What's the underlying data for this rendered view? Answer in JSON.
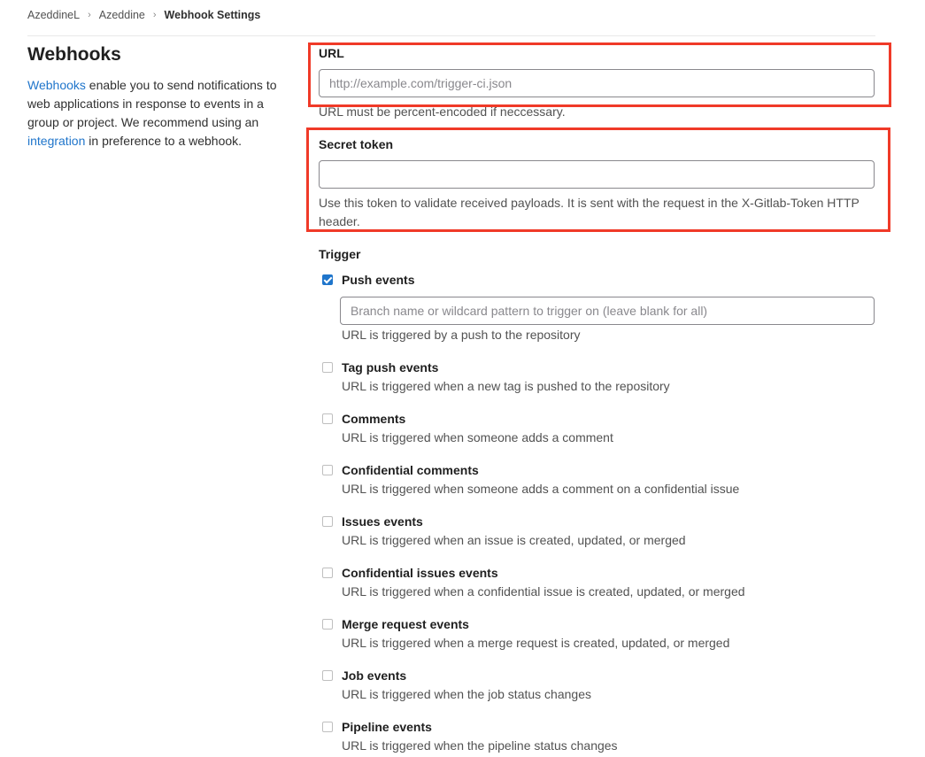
{
  "breadcrumb": {
    "items": [
      "AzeddineL",
      "Azeddine",
      "Webhook Settings"
    ]
  },
  "sidebar": {
    "title": "Webhooks",
    "webhooks_link": "Webhooks",
    "text_part1": " enable you to send notifications to web applications in response to events in a group or project. We recommend using an ",
    "integration_link": "integration",
    "text_part2": " in preference to a webhook."
  },
  "url_field": {
    "label": "URL",
    "placeholder": "http://example.com/trigger-ci.json",
    "value": "",
    "help": "URL must be percent-encoded if neccessary."
  },
  "secret_token": {
    "label": "Secret token",
    "value": "",
    "help": "Use this token to validate received payloads. It is sent with the request in the X-Gitlab-Token HTTP header."
  },
  "trigger": {
    "heading": "Trigger",
    "push_branch_placeholder": "Branch name or wildcard pattern to trigger on (leave blank for all)",
    "events": [
      {
        "title": "Push events",
        "desc": "URL is triggered by a push to the repository",
        "checked": true
      },
      {
        "title": "Tag push events",
        "desc": "URL is triggered when a new tag is pushed to the repository",
        "checked": false
      },
      {
        "title": "Comments",
        "desc": "URL is triggered when someone adds a comment",
        "checked": false
      },
      {
        "title": "Confidential comments",
        "desc": "URL is triggered when someone adds a comment on a confidential issue",
        "checked": false
      },
      {
        "title": "Issues events",
        "desc": "URL is triggered when an issue is created, updated, or merged",
        "checked": false
      },
      {
        "title": "Confidential issues events",
        "desc": "URL is triggered when a confidential issue is created, updated, or merged",
        "checked": false
      },
      {
        "title": "Merge request events",
        "desc": "URL is triggered when a merge request is created, updated, or merged",
        "checked": false
      },
      {
        "title": "Job events",
        "desc": "URL is triggered when the job status changes",
        "checked": false
      },
      {
        "title": "Pipeline events",
        "desc": "URL is triggered when the pipeline status changes",
        "checked": false
      }
    ]
  },
  "colors": {
    "link": "#1f75cb",
    "highlight": "#f03a28",
    "checkbox_checked": "#1f75cb"
  }
}
